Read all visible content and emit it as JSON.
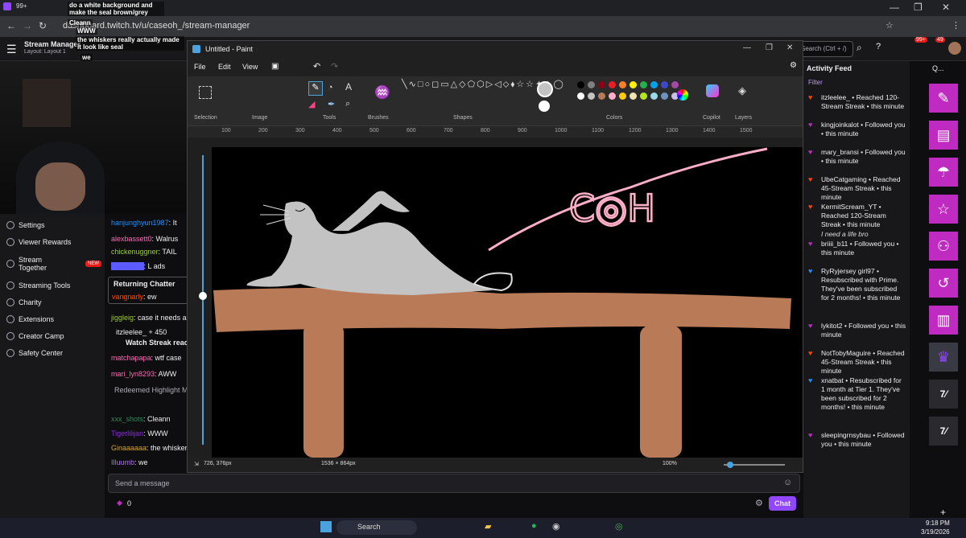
{
  "browser": {
    "url": "dashboard.twitch.tv/u/caseoh_/stream-manager",
    "tab_count_badge": "99+",
    "window_controls": [
      "—",
      "❐",
      "✕"
    ]
  },
  "overlay_chat": [
    {
      "user": "",
      "msg": "do a white background and make the seal brown/grey"
    },
    {
      "user": "",
      "msg": "Cleann"
    },
    {
      "user": "",
      "msg": "WWW"
    },
    {
      "user": "",
      "msg": "the whiskers really actually made it look like seal"
    },
    {
      "user": "",
      "msg": "we"
    }
  ],
  "twitch_header": {
    "title": "Stream Manager",
    "layout": "Layout: Layout 1",
    "search_placeholder": "Search (Ctrl + /)",
    "notif_badge": "99+",
    "whisper_badge": "49"
  },
  "left_nav": [
    {
      "label": "Settings"
    },
    {
      "label": "Viewer Rewards"
    },
    {
      "label": "Stream Together",
      "badge": "NEW"
    },
    {
      "label": "Streaming Tools"
    },
    {
      "label": "Charity"
    },
    {
      "label": "Extensions"
    },
    {
      "label": "Creator Camp"
    },
    {
      "label": "Safety Center"
    }
  ],
  "chat": {
    "returning_label": "Returning Chatter",
    "lines": [
      {
        "user": "hanjunghyun1987",
        "msg": ": It",
        "color": "#1e90ff"
      },
      {
        "user": "alexbassett0",
        "msg": ": Walrus",
        "color": "#ff69b4"
      },
      {
        "user": "chickenuggner",
        "msg": ": TAIL",
        "color": "#9acd32"
      },
      {
        "user": "",
        "msg": ": L ads",
        "color": "#5b5bff"
      },
      {
        "user": "vangnarly",
        "msg": ": ew",
        "color": "#ff4500"
      },
      {
        "user": "jiggleig",
        "msg": ": case it needs a",
        "color": "#9acd32"
      },
      {
        "user": "itzleelee_",
        "msg": " + 450",
        "color": "#efeff1"
      },
      {
        "user": "",
        "msg": "Watch Streak reach",
        "color": "#efeff1"
      },
      {
        "user": "matchapapa",
        "msg": ": wtf case",
        "color": "#ff69b4"
      },
      {
        "user": "mari_lyn8293",
        "msg": ": AWW",
        "color": "#ff69b4"
      },
      {
        "user": "",
        "msg": "Redeemed Highlight My",
        "color": "#adadb8"
      },
      {
        "user": "xxx_shots",
        "msg": ": Cleann",
        "color": "#2e8b57"
      },
      {
        "user": "Tigerlilijan",
        "msg": ": WWW",
        "color": "#8a2be2"
      },
      {
        "user": "Ginaaaaaa",
        "msg": ": the whiskers",
        "color": "#daa520"
      },
      {
        "user": "Illuumb",
        "msg": ": we",
        "color": "#b06bff"
      }
    ],
    "input_placeholder": "Send a message",
    "points": "0",
    "chat_button": "Chat"
  },
  "paint": {
    "title": "Untitled - Paint",
    "menu": [
      "File",
      "Edit",
      "View"
    ],
    "ribbon_groups": [
      "Selection",
      "Image",
      "Tools",
      "Brushes",
      "Shapes",
      "Colors",
      "Copilot",
      "Layers"
    ],
    "ruler_ticks": [
      "100",
      "200",
      "300",
      "400",
      "500",
      "600",
      "700",
      "800",
      "900",
      "1000",
      "1100",
      "1200",
      "1300",
      "1400",
      "1500"
    ],
    "cursor_pos": "726, 376px",
    "canvas_size": "1536 × 864px",
    "zoom": "100%",
    "colors": [
      "#000000",
      "#7f7f7f",
      "#880015",
      "#ed1c24",
      "#ff7f27",
      "#fff200",
      "#22b14c",
      "#00a2e8",
      "#3f48cc",
      "#a349a4",
      "#ffffff",
      "#c3c3c3",
      "#b97a57",
      "#ffaec9",
      "#ffc90e",
      "#efe4b0",
      "#b5e61d",
      "#99d9ea",
      "#7092be",
      "#c8bfe7"
    ],
    "drawing_text": "C◎H"
  },
  "activity_feed": {
    "title": "Activity Feed",
    "filter": "Filter",
    "items": [
      {
        "text": "itzleelee_ • Reached 120-Stream Streak • this minute",
        "icon_color": "#ff4500"
      },
      {
        "text": "kingjoinkalot • Followed you • this minute",
        "icon_color": "#bf2bc0"
      },
      {
        "text": "mary_bransi • Followed you • this minute",
        "icon_color": "#bf2bc0"
      },
      {
        "text": "UbeCatgaming • Reached 45-Stream Streak • this minute",
        "icon_color": "#ff4500"
      },
      {
        "text": "KermitScream_YT • Reached 120-Stream Streak • this minute",
        "icon_color": "#ff4500",
        "note": "I need a life bro"
      },
      {
        "text": "briiii_b11 • Followed you • this minute",
        "icon_color": "#bf2bc0"
      },
      {
        "text": "RyRyjersey girl97 • Resubscribed with Prime. They've been subscribed for 2 months! • this minute",
        "icon_color": "#1e90ff"
      },
      {
        "text": "lykitot2 • Followed you • this minute",
        "icon_color": "#bf2bc0"
      },
      {
        "text": "NotTobyMaguire • Reached 45-Stream Streak • this minute",
        "icon_color": "#ff4500"
      },
      {
        "text": "xnatbat • Resubscribed for 1 month at Tier 1. They've been subscribed for 2 months! • this minute",
        "icon_color": "#1e90ff"
      },
      {
        "text": "sleepingrnsybau • Followed you • this minute",
        "icon_color": "#bf2bc0"
      }
    ]
  },
  "right_strip": {
    "quick_label": "Q..."
  },
  "taskbar": {
    "search": "Search",
    "time": "9:18 PM",
    "date": "3/19/2026"
  }
}
